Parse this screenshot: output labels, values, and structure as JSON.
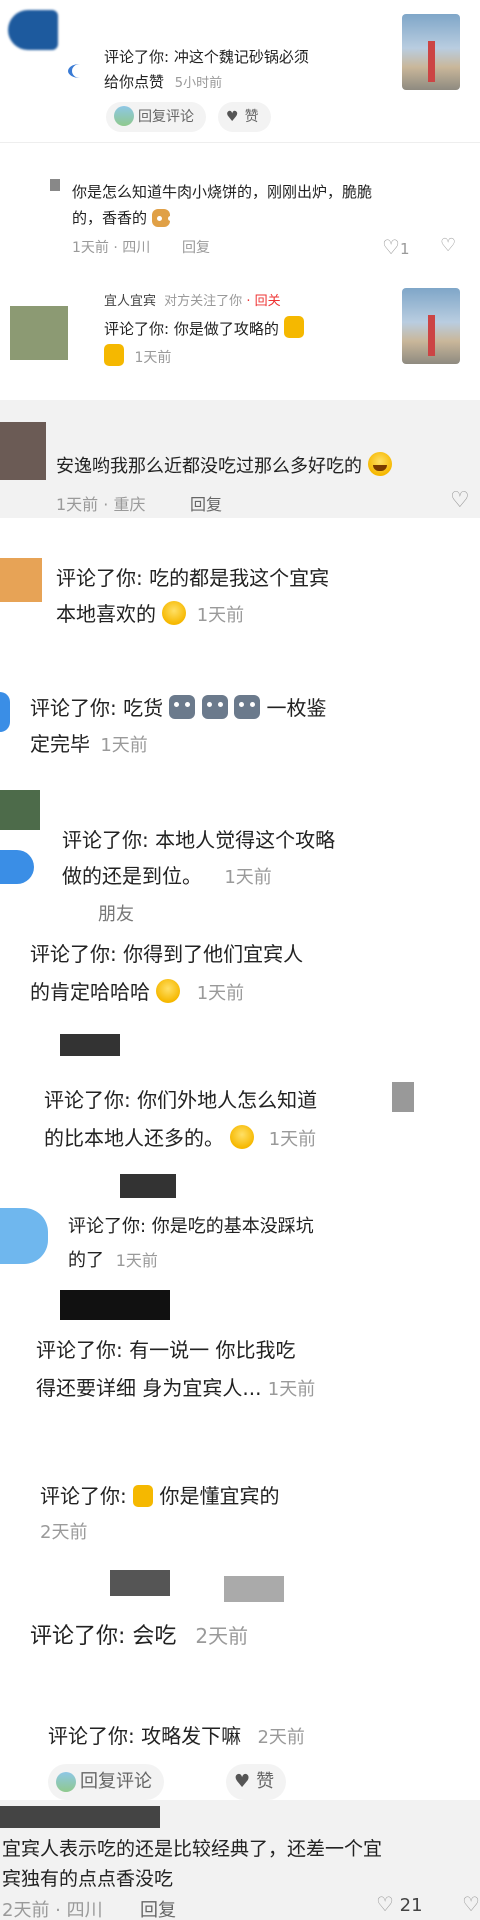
{
  "items": [
    {
      "text": "评论了你: 冲这个魏记砂锅必须",
      "text2": "给你点赞",
      "time": "5小时前",
      "reply": "回复评论",
      "like": "赞"
    },
    {
      "text": "你是怎么知道牛肉小烧饼的，刚刚出炉，脆脆",
      "text2": "的，香香的",
      "meta": "1天前 · 四川",
      "reply": "回复",
      "likes": "1"
    },
    {
      "name": "宜人宜宾",
      "followed": "对方关注了你",
      "follow_back": "· 回关",
      "text": "评论了你: 你是做了攻略的",
      "time": "1天前"
    },
    {
      "text": "安逸哟我那么近都没吃过那么多好吃的",
      "meta": "1天前 · 重庆",
      "reply": "回复"
    },
    {
      "text": "评论了你: 吃的都是我这个宜宾",
      "text2": "本地喜欢的",
      "time": "1天前"
    },
    {
      "text": "评论了你: 吃货",
      "text2": "一枚鉴",
      "text3": "定完毕",
      "time": "1天前"
    },
    {
      "text": "评论了你: 本地人觉得这个攻略",
      "text2": "做的还是到位。",
      "time": "1天前",
      "tag": "朋友"
    },
    {
      "text": "评论了你: 你得到了他们宜宾人",
      "text2": "的肯定哈哈哈",
      "time": "1天前"
    },
    {
      "text": "评论了你: 你们外地人怎么知道",
      "text2": "的比本地人还多的。",
      "time": "1天前"
    },
    {
      "text": "评论了你: 你是吃的基本没踩坑",
      "text2": "的了",
      "time": "1天前"
    },
    {
      "text": "评论了你: 有一说一 你比我吃",
      "text2": "得还要详细 身为宜宾人...",
      "time": "1天前"
    },
    {
      "text": "评论了你: ",
      "text2": "你是懂宜宾的",
      "time": "2天前"
    },
    {
      "text": "评论了你: 会吃",
      "time": "2天前"
    },
    {
      "text": "评论了你: 攻略发下嘛",
      "time": "2天前",
      "reply": "回复评论",
      "like": "赞"
    },
    {
      "text": "宜宾人表示吃的还是比较经典了，还差一个宜",
      "text2": "宾独有的点点香没吃",
      "meta": "2天前 · 四川",
      "reply": "回复",
      "likes": "21"
    }
  ]
}
